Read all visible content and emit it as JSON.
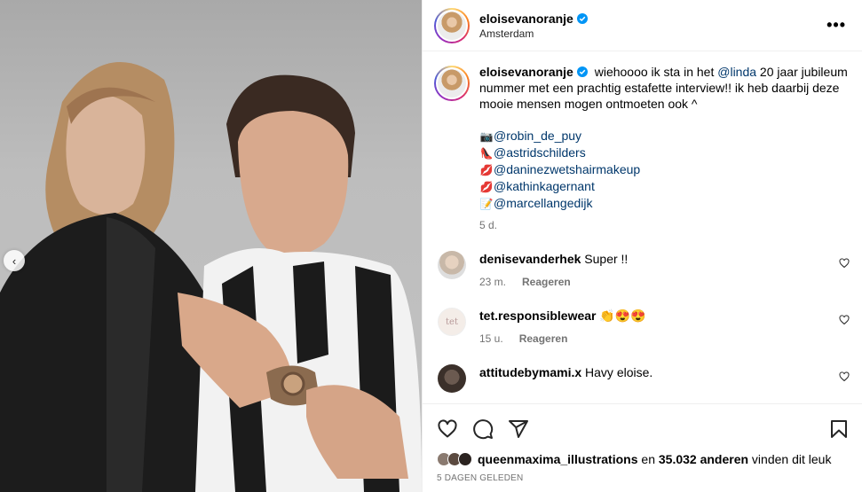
{
  "post": {
    "username": "eloisevanoranje",
    "location": "Amsterdam",
    "more_label": "•••",
    "prev_label": "‹"
  },
  "caption": {
    "username": "eloisevanoranje",
    "text_before_mention": "wiehoooo ik sta in het ",
    "mention": "@linda",
    "text_after_mention": " 20 jaar jubileum nummer met een prachtig estafette interview!! ik heb daarbij deze mooie mensen mogen ontmoeten ook ^",
    "tags": [
      {
        "emoji": "📷",
        "handle": "@robin_de_puy"
      },
      {
        "emoji": "👠",
        "handle": "@astridschilders"
      },
      {
        "emoji": "💋",
        "handle": "@daninezwetshairmakeup"
      },
      {
        "emoji": "💋",
        "handle": "@kathinkagernant"
      },
      {
        "emoji": "📝",
        "handle": "@marcellangedijk"
      }
    ],
    "age": "5 d."
  },
  "comments": [
    {
      "username": "denisevanderhek",
      "text": "Super !!",
      "age": "23 m.",
      "reply_label": "Reageren"
    },
    {
      "username": "tet.responsiblewear",
      "text": "👏😍😍",
      "age": "15 u.",
      "reply_label": "Reageren"
    },
    {
      "username": "attitudebymami.x",
      "text": "Havy eloise.",
      "age": "",
      "reply_label": ""
    }
  ],
  "likes": {
    "user": "queenmaxima_illustrations",
    "connector": " en ",
    "count": "35.032 anderen",
    "suffix": " vinden dit leuk"
  },
  "date_label": "5 DAGEN GELEDEN",
  "icons": [
    "like-heart-icon",
    "comment-icon",
    "share-icon",
    "bookmark-icon",
    "verified-icon",
    "more-icon"
  ],
  "colors": {
    "verified": "#0095f6",
    "mention": "#00376b",
    "meta": "#737373"
  }
}
